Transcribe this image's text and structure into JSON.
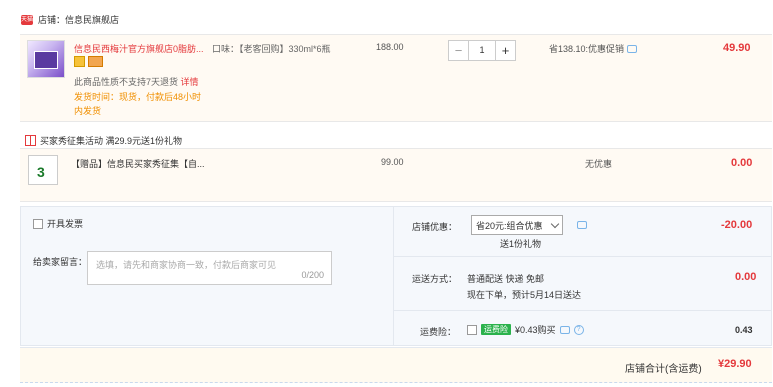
{
  "store": {
    "badge": "天猫",
    "label": "店铺：信息民旗舰店"
  },
  "product": {
    "title": "信息民西梅汁官方旗舰店0脂肪...",
    "note_prefix": "此商品性质不支持7天退货",
    "note_link": "详情",
    "shipping": "发货时间：现货，付款后48小时内发货",
    "spec": "口味：【老客回购】330ml*6瓶",
    "unit_price": "188.00",
    "quantity": "1",
    "minus": "−",
    "plus": "+",
    "promo": "省138.10:优惠促销",
    "subtotal": "49.90"
  },
  "gift": {
    "header": "买家秀征集活动   满29.9元送1份礼物",
    "thumb_num": "3",
    "title": "【赠品】信息民买家秀征集【自...",
    "price": "99.00",
    "promo": "无优惠",
    "subtotal": "0.00"
  },
  "order": {
    "invoice_label": "开具发票",
    "message_label": "给卖家留言：",
    "message_placeholder": "选填，请先和商家协商一致，付款后商家可见",
    "message_count": "0/200",
    "discount_label": "店铺优惠：",
    "discount_selected": "省20元:组合优惠",
    "discount_gift": "送1份礼物",
    "discount_amount": "-20.00",
    "shipping_label": "运送方式：",
    "shipping_line1": "普通配送 快递 免邮",
    "shipping_line2": "现在下单，预计5月14日送达",
    "shipping_amount": "0.00",
    "insurance_label": "运费险：",
    "insurance_badge": "运费险",
    "insurance_text": "¥0.43购买",
    "insurance_amount": "0.43",
    "help": "?"
  },
  "total": {
    "label": "店铺合计(含运费)",
    "amount": "¥29.90"
  },
  "colors": {
    "accent": "#e4393c",
    "orange": "#f08f00",
    "green": "#2bb24c"
  }
}
